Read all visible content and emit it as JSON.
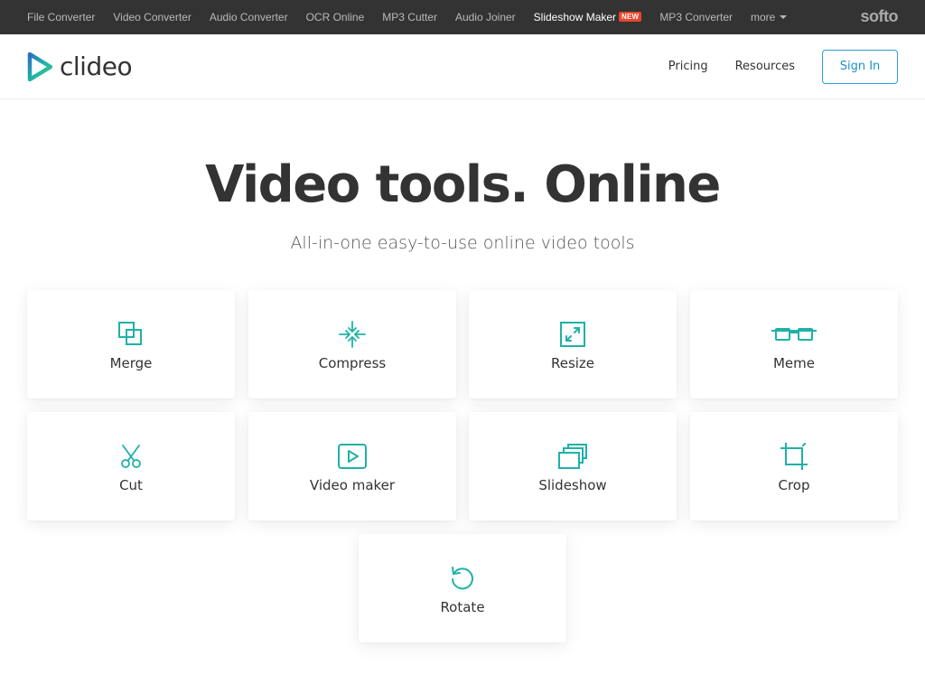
{
  "topbar": {
    "items": [
      {
        "label": "File Converter"
      },
      {
        "label": "Video Converter"
      },
      {
        "label": "Audio Converter"
      },
      {
        "label": "OCR Online"
      },
      {
        "label": "MP3 Cutter"
      },
      {
        "label": "Audio Joiner"
      },
      {
        "label": "Slideshow Maker",
        "badge": "NEW"
      },
      {
        "label": "MP3 Converter"
      },
      {
        "label": "more"
      }
    ],
    "logo": "softo"
  },
  "header": {
    "brand": "clideo",
    "nav": {
      "pricing": "Pricing",
      "resources": "Resources"
    },
    "sign_in": "Sign In"
  },
  "hero": {
    "title": "Video tools. Online",
    "subtitle": "All-in-one easy-to-use online video tools"
  },
  "tools": [
    {
      "label": "Merge",
      "icon": "merge-icon"
    },
    {
      "label": "Compress",
      "icon": "compress-icon"
    },
    {
      "label": "Resize",
      "icon": "resize-icon"
    },
    {
      "label": "Meme",
      "icon": "glasses-icon"
    },
    {
      "label": "Cut",
      "icon": "scissors-icon"
    },
    {
      "label": "Video maker",
      "icon": "play-icon"
    },
    {
      "label": "Slideshow",
      "icon": "slideshow-icon"
    },
    {
      "label": "Crop",
      "icon": "crop-icon"
    },
    {
      "label": "Rotate",
      "icon": "rotate-icon"
    }
  ],
  "colors": {
    "accent": "#1fb2a6",
    "topbar_bg": "#333333",
    "new_badge": "#e8452c",
    "sign_in": "#2a9dd4"
  }
}
